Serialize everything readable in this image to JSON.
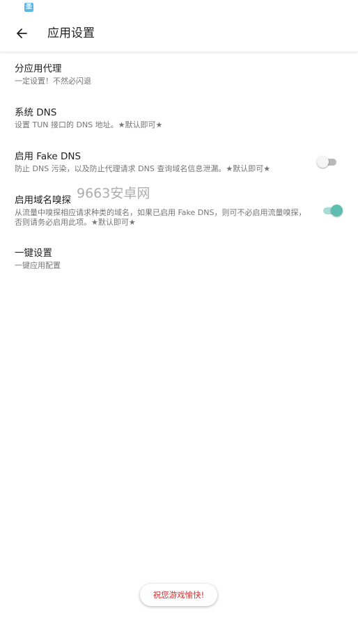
{
  "status_bar": {
    "app_icon": "app-notification-icon",
    "app_icon_glyph": "圣"
  },
  "header": {
    "title": "应用设置",
    "back_icon": "arrow-left-icon"
  },
  "preferences": [
    {
      "title": "分应用代理",
      "summary": "一定设置！不然必闪退"
    },
    {
      "title": "系统 DNS",
      "summary": "设置 TUN 接口的 DNS 地址。★默认即可★"
    },
    {
      "title": "启用 Fake DNS",
      "summary": "防止 DNS 污染，以及防止代理请求 DNS 查询域名信息泄漏。★默认即可★",
      "switch_on": false
    },
    {
      "title": "启用域名嗅探",
      "summary": "从流量中嗅探相应请求种类的域名，如果已启用 Fake DNS，则可不必启用流量嗅探，否则请务必启用此项。★默认即可★",
      "switch_on": true
    },
    {
      "title": "一键设置",
      "summary": "一键应用配置"
    }
  ],
  "watermark": "9663安卓网",
  "toast": "祝您游戏愉快!",
  "colors": {
    "accent": "#5dbdb1",
    "accent_track": "#a8dcd6",
    "toast_text": "#d32f2f",
    "summary_text": "#757575"
  }
}
